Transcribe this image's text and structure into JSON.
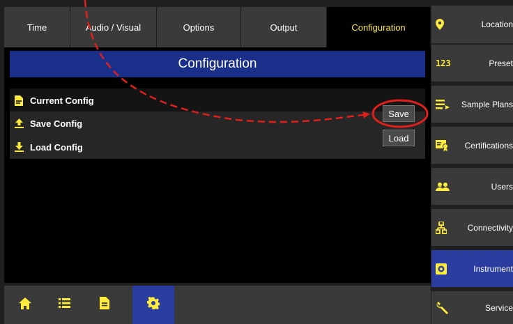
{
  "colors": {
    "accent": "#ffeb3b",
    "title_bar": "#1a2f8a",
    "active_blue": "#2c3da0",
    "annotation_red": "#e0201c"
  },
  "tabs": [
    {
      "label": "Time",
      "active": false
    },
    {
      "label": "Audio / Visual",
      "active": false
    },
    {
      "label": "Options",
      "active": false
    },
    {
      "label": "Output",
      "active": false
    },
    {
      "label": "Configuration",
      "active": true
    }
  ],
  "page": {
    "title": "Configuration"
  },
  "rows": [
    {
      "label": "Current Config",
      "icon": "document-icon"
    },
    {
      "label": "Save Config",
      "icon": "upload-icon",
      "button": "Save"
    },
    {
      "label": "Load Config",
      "icon": "download-icon",
      "button": "Load"
    }
  ],
  "bottom_nav": [
    {
      "icon": "home-icon",
      "active": false
    },
    {
      "icon": "list-icon",
      "active": false
    },
    {
      "icon": "document-icon",
      "active": false
    },
    {
      "icon": "gear-icon",
      "active": true
    }
  ],
  "sidebar": [
    {
      "label": "Location",
      "icon": "location-pin-icon",
      "active": false
    },
    {
      "label": "Preset",
      "icon": "123-icon",
      "icon_text": "123",
      "active": false
    },
    {
      "label": "Sample Plans",
      "icon": "playlist-icon",
      "active": false
    },
    {
      "label": "Certifications",
      "icon": "certificate-icon",
      "active": false
    },
    {
      "label": "Users",
      "icon": "users-icon",
      "active": false
    },
    {
      "label": "Connectivity",
      "icon": "network-icon",
      "active": false
    },
    {
      "label": "Instrument",
      "icon": "instrument-gear-icon",
      "active": true
    },
    {
      "label": "Service",
      "icon": "wrench-icon",
      "active": false
    }
  ]
}
